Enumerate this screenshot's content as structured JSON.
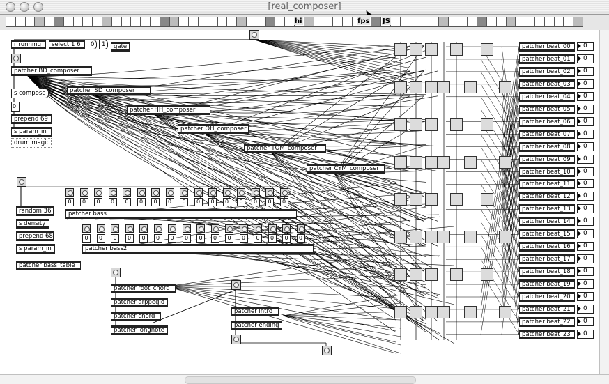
{
  "window": {
    "title": "[real_composer]"
  },
  "toolbar": {
    "fps_label": "fps",
    "js_label": "JS",
    "hi_label": "hi",
    "buttons": 60
  },
  "top_objects": {
    "r_running": "r running",
    "select": "select 1 6",
    "num_0": "0",
    "num_1": "1",
    "gate": "gate",
    "patcher_bd": "patcher BD_composer",
    "s_compose": "s compose",
    "num_zero": "0",
    "prepend69": "prepend 69",
    "s_param_in": "s param_in",
    "drum_magic": "drum magic"
  },
  "middle_patchers": [
    "patcher SD_composer",
    "patcher HH_composer",
    "patcher OH_composer",
    "patcher TOM_composer",
    "patcher CYM_composer"
  ],
  "bass_objects": {
    "random": "random 36",
    "s_density": "s density",
    "prepend68": "prepend 68",
    "s_param_in2": "s param_in",
    "patcher_bass_table": "patcher bass_table",
    "patcher_bass": "patcher bass",
    "patcher_bass2": "patcher bass2",
    "num_zero_label": "0"
  },
  "chord_objects": {
    "root_chord": "patcher root_chord",
    "arpeggio": "patcher arppegio",
    "chord": "patcher chord",
    "longnote": "patcher longnote",
    "intro": "patcher intro",
    "ending": "patcher ending"
  },
  "beats": {
    "labels": [
      "patcher beat_00",
      "patcher beat_01",
      "patcher beat_02",
      "patcher beat_03",
      "patcher beat_04",
      "patcher beat_05",
      "patcher beat_06",
      "patcher beat_07",
      "patcher beat_08",
      "patcher beat_09",
      "patcher beat_10",
      "patcher beat_11",
      "patcher beat_12",
      "patcher beat_13",
      "patcher beat_14",
      "patcher beat_15",
      "patcher beat_16",
      "patcher beat_17",
      "patcher beat_18",
      "patcher beat_19",
      "patcher beat_20",
      "patcher beat_21",
      "patcher beat_22",
      "patcher beat_23"
    ],
    "value": "0"
  }
}
